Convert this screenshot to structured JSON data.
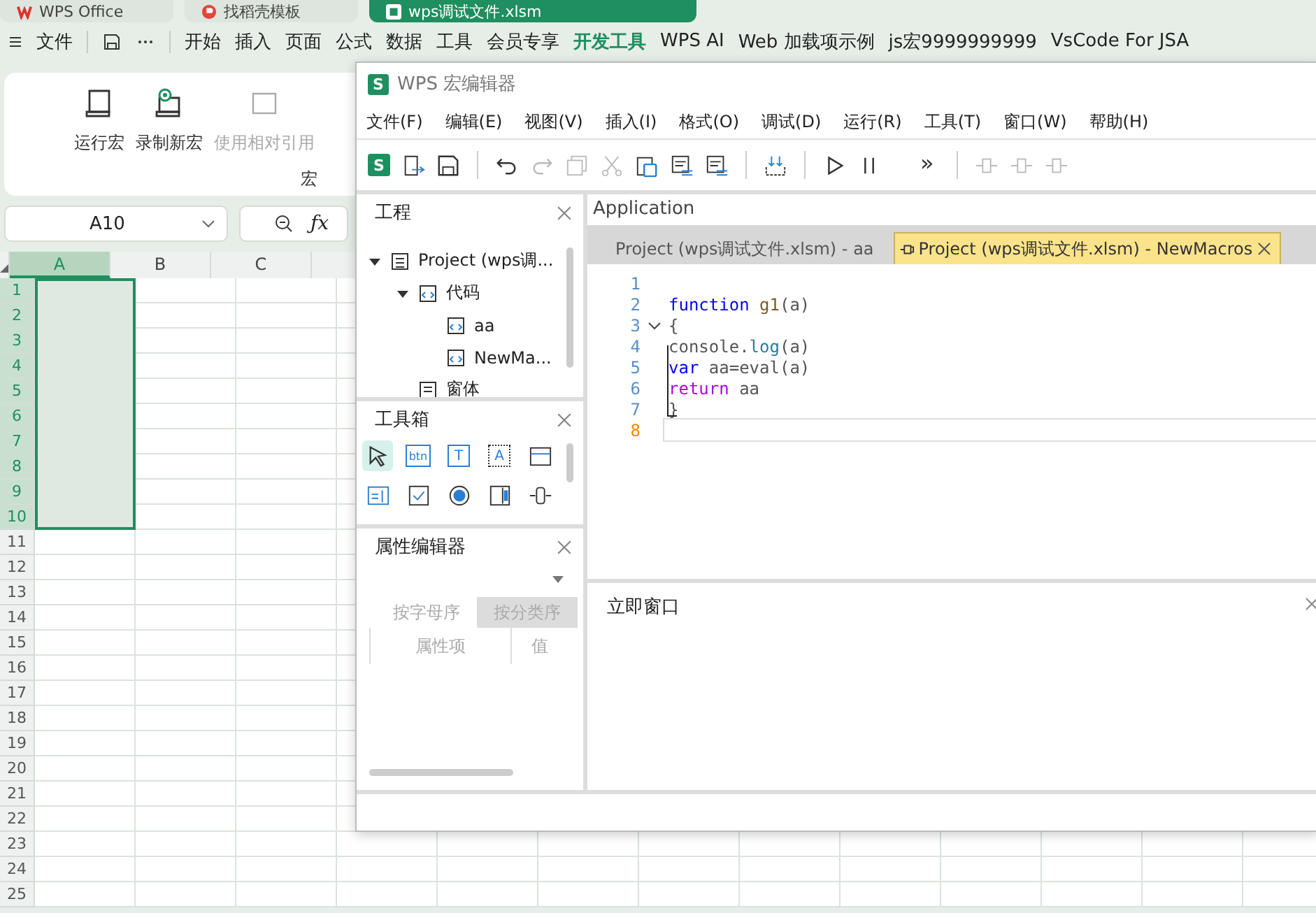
{
  "app_tabs": [
    {
      "label": "WPS Office",
      "kind": "home",
      "selected": false
    },
    {
      "label": "找稻壳模板",
      "kind": "template",
      "selected": false
    },
    {
      "label": "wps调试文件.xlsm",
      "kind": "sheet",
      "selected": true
    }
  ],
  "menu": {
    "file": "文件",
    "items": [
      {
        "label": "开始",
        "selected": false
      },
      {
        "label": "插入",
        "selected": false
      },
      {
        "label": "页面",
        "selected": false
      },
      {
        "label": "公式",
        "selected": false
      },
      {
        "label": "数据",
        "selected": false
      },
      {
        "label": "工具",
        "selected": false
      },
      {
        "label": "会员专享",
        "selected": false
      },
      {
        "label": "开发工具",
        "selected": true
      },
      {
        "label": "WPS AI",
        "selected": false
      },
      {
        "label": "Web 加载项示例",
        "selected": false
      },
      {
        "label": "js宏9999999999",
        "selected": false
      },
      {
        "label": "VsCode For JSA",
        "selected": false
      }
    ]
  },
  "ribbon": {
    "buttons": [
      {
        "label": "运行宏",
        "kind": "run",
        "disabled": false
      },
      {
        "label": "录制新宏",
        "kind": "record",
        "disabled": false
      },
      {
        "label": "使用相对引用",
        "kind": "relative",
        "disabled": true
      }
    ],
    "group": "宏"
  },
  "formula_bar": {
    "name_box": "A10",
    "fx": "ƒx"
  },
  "sheet": {
    "columns": [
      {
        "label": "A",
        "selected": true
      },
      {
        "label": "B",
        "selected": false
      },
      {
        "label": "C",
        "selected": false
      }
    ],
    "rows": [
      {
        "label": "1",
        "selected": true
      },
      {
        "label": "2",
        "selected": true
      },
      {
        "label": "3",
        "selected": true
      },
      {
        "label": "4",
        "selected": true
      },
      {
        "label": "5",
        "selected": true
      },
      {
        "label": "6",
        "selected": true
      },
      {
        "label": "7",
        "selected": true
      },
      {
        "label": "8",
        "selected": true
      },
      {
        "label": "9",
        "selected": true
      },
      {
        "label": "10",
        "selected": true
      },
      {
        "label": "11",
        "selected": false
      },
      {
        "label": "12",
        "selected": false
      },
      {
        "label": "13",
        "selected": false
      },
      {
        "label": "14",
        "selected": false
      },
      {
        "label": "15",
        "selected": false
      },
      {
        "label": "16",
        "selected": false
      },
      {
        "label": "17",
        "selected": false
      },
      {
        "label": "18",
        "selected": false
      },
      {
        "label": "19",
        "selected": false
      },
      {
        "label": "20",
        "selected": false
      },
      {
        "label": "21",
        "selected": false
      },
      {
        "label": "22",
        "selected": false
      },
      {
        "label": "23",
        "selected": false
      },
      {
        "label": "24",
        "selected": false
      },
      {
        "label": "25",
        "selected": false
      }
    ]
  },
  "editor": {
    "logo": "S",
    "title": "WPS 宏编辑器",
    "menu": [
      "文件(F)",
      "编辑(E)",
      "视图(V)",
      "插入(I)",
      "格式(O)",
      "调试(D)",
      "运行(R)",
      "工具(T)",
      "窗口(W)",
      "帮助(H)"
    ],
    "toolbar": [
      {
        "kind": "logo",
        "text": "S"
      },
      {
        "kind": "export",
        "disabled": false
      },
      {
        "kind": "save",
        "disabled": false
      },
      {
        "kind": "sep"
      },
      {
        "kind": "undo",
        "disabled": false
      },
      {
        "kind": "redo",
        "disabled": true
      },
      {
        "kind": "copy",
        "disabled": true
      },
      {
        "kind": "cut",
        "disabled": true
      },
      {
        "kind": "paste",
        "disabled": false
      },
      {
        "kind": "comment",
        "disabled": false
      },
      {
        "kind": "uncomment",
        "disabled": false
      },
      {
        "kind": "sep"
      },
      {
        "kind": "compile",
        "disabled": false
      },
      {
        "kind": "sep"
      },
      {
        "kind": "run",
        "disabled": false
      },
      {
        "kind": "pause",
        "disabled": false
      },
      {
        "kind": "more",
        "text": "»"
      },
      {
        "kind": "sep"
      },
      {
        "kind": "step-into",
        "disabled": true
      },
      {
        "kind": "step-over",
        "disabled": true
      },
      {
        "kind": "step-out",
        "disabled": true
      }
    ],
    "project": {
      "title": "工程",
      "tree": [
        {
          "label": "Project (wps调...",
          "kind": "project",
          "expanded": true,
          "children": [
            {
              "label": "代码",
              "kind": "folder",
              "expanded": true,
              "children": [
                {
                  "label": "aa",
                  "kind": "module"
                },
                {
                  "label": "NewMa...",
                  "kind": "module"
                }
              ]
            },
            {
              "label": "窗体",
              "kind": "form"
            }
          ]
        }
      ]
    },
    "toolbox": {
      "title": "工具箱",
      "tools": [
        {
          "kind": "pointer",
          "selected": true
        },
        {
          "kind": "button",
          "text": "btn",
          "selected": false
        },
        {
          "kind": "textbox",
          "text": "T",
          "selected": false
        },
        {
          "kind": "label",
          "text": "A",
          "selected": false
        },
        {
          "kind": "frame",
          "selected": false
        },
        {
          "kind": "list",
          "selected": false
        },
        {
          "kind": "checkbox",
          "selected": false
        },
        {
          "kind": "radio",
          "selected": false
        },
        {
          "kind": "scrollbar",
          "selected": false
        },
        {
          "kind": "spin",
          "selected": false
        }
      ]
    },
    "properties": {
      "title": "属性编辑器",
      "sort_tabs": [
        {
          "label": "按字母序",
          "selected": false
        },
        {
          "label": "按分类序",
          "selected": true
        }
      ],
      "columns": [
        "属性项",
        "值"
      ]
    },
    "object_field": "Application",
    "doc_tabs": [
      {
        "label": "Project (wps调试文件.xlsm) - aa",
        "selected": false
      },
      {
        "label": "Project (wps调试文件.xlsm) - NewMacros",
        "selected": true
      }
    ],
    "code": [
      {
        "n": "1",
        "fold": false,
        "current": false
      },
      {
        "n": "2",
        "fold": false,
        "current": false,
        "tokens": [
          {
            "kind": "keyword",
            "text": "function"
          },
          {
            "kind": "function",
            "text": " g1"
          },
          {
            "kind": "plain",
            "text": "(a)"
          }
        ]
      },
      {
        "n": "3",
        "fold": true,
        "current": false,
        "tokens": [
          {
            "kind": "plain",
            "text": "{"
          }
        ]
      },
      {
        "n": "4",
        "fold": false,
        "current": false,
        "tokens": [
          {
            "kind": "plain",
            "text": "console."
          },
          {
            "kind": "method",
            "text": "log"
          },
          {
            "kind": "plain",
            "text": "(a)"
          }
        ]
      },
      {
        "n": "5",
        "fold": false,
        "current": false,
        "tokens": [
          {
            "kind": "keyword",
            "text": "var"
          },
          {
            "kind": "plain",
            "text": " aa=eval(a)"
          }
        ]
      },
      {
        "n": "6",
        "fold": false,
        "current": false,
        "tokens": [
          {
            "kind": "control",
            "text": "return"
          },
          {
            "kind": "plain",
            "text": " aa"
          }
        ]
      },
      {
        "n": "7",
        "fold": false,
        "current": false,
        "tokens": [
          {
            "kind": "plain",
            "text": "}"
          }
        ]
      },
      {
        "n": "8",
        "fold": false,
        "current": true
      }
    ],
    "immediate": {
      "title": "立即窗口"
    }
  }
}
